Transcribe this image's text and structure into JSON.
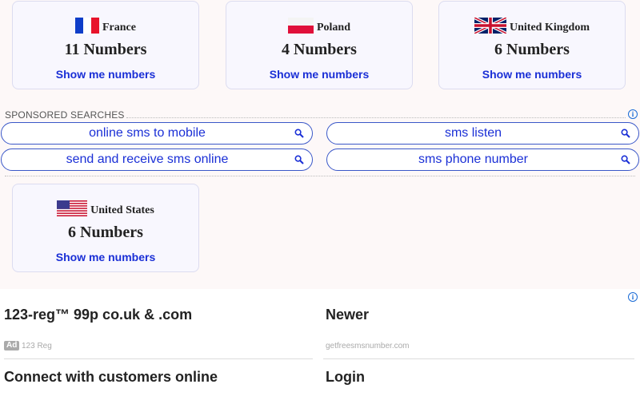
{
  "cards": [
    {
      "country": "France",
      "count": "11 Numbers",
      "link": "Show me numbers"
    },
    {
      "country": "Poland",
      "count": "4 Numbers",
      "link": "Show me numbers"
    },
    {
      "country": "United Kingdom",
      "count": "6 Numbers",
      "link": "Show me numbers"
    },
    {
      "country": "United States",
      "count": "6 Numbers",
      "link": "Show me numbers"
    }
  ],
  "sponsored": {
    "label": "SPONSORED SEARCHES",
    "items": [
      "online sms to mobile",
      "sms listen",
      "send and receive sms online",
      "sms phone number"
    ]
  },
  "ads": {
    "left_title": "123-reg™ 99p co.uk & .com",
    "left_badge": "Ad",
    "left_source": "123 Reg",
    "left_title2": "Connect with customers online",
    "right_title": "Newer",
    "right_source": "getfreesmsnumber.com",
    "right_title2": "Login"
  },
  "icons": {
    "info": "info-icon",
    "search": "search-icon",
    "flags": [
      "france-flag-icon",
      "poland-flag-icon",
      "uk-flag-icon",
      "us-flag-icon"
    ]
  }
}
